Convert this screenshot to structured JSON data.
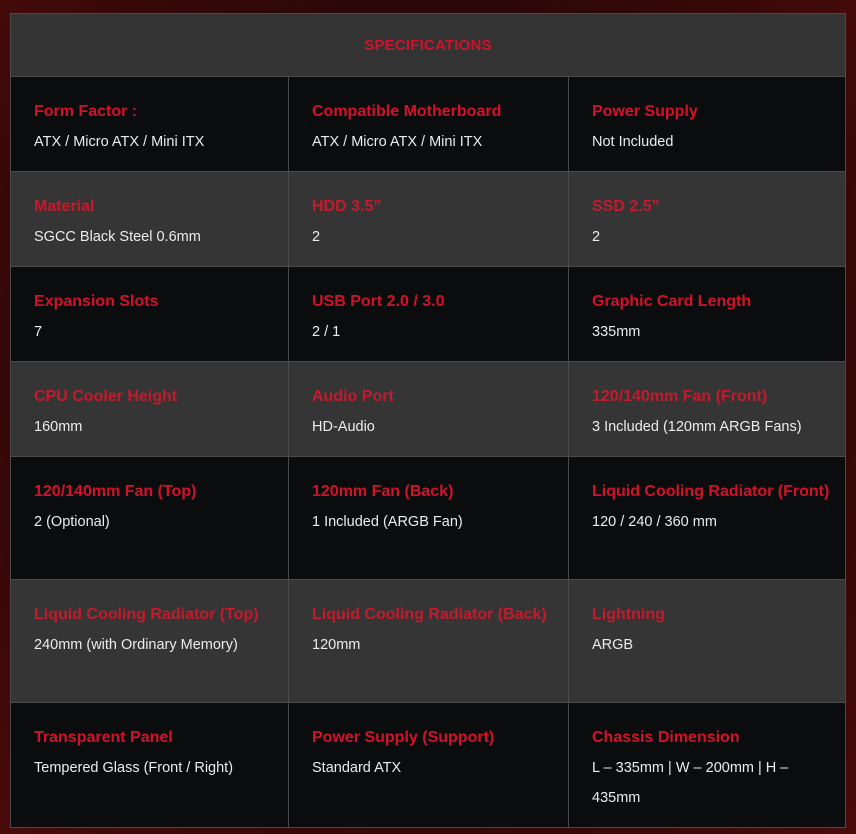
{
  "header": {
    "title": "SPECIFICATIONS"
  },
  "rows": [
    [
      {
        "label": "Form Factor :",
        "value": "ATX / Micro ATX / Mini ITX"
      },
      {
        "label": "Compatible Motherboard",
        "value": "ATX / Micro ATX / Mini ITX"
      },
      {
        "label": "Power Supply",
        "value": "Not Included"
      }
    ],
    [
      {
        "label": "Material",
        "value": "SGCC Black Steel 0.6mm"
      },
      {
        "label": "HDD 3.5”",
        "value": "2"
      },
      {
        "label": "SSD 2.5”",
        "value": "2"
      }
    ],
    [
      {
        "label": "Expansion Slots",
        "value": "7"
      },
      {
        "label": "USB Port 2.0 / 3.0",
        "value": "2 / 1"
      },
      {
        "label": "Graphic Card Length",
        "value": "335mm"
      }
    ],
    [
      {
        "label": "CPU Cooler Height",
        "value": "160mm"
      },
      {
        "label": "Audio Port",
        "value": "HD-Audio"
      },
      {
        "label": "120/140mm Fan (Front)",
        "value": "3 Included (120mm ARGB Fans)"
      }
    ],
    [
      {
        "label": "120/140mm Fan (Top)",
        "value": "2 (Optional)"
      },
      {
        "label": "120mm Fan (Back)",
        "value": "1 Included (ARGB Fan)"
      },
      {
        "label": "Liquid Cooling Radiator (Front)",
        "value": "120 / 240 / 360 mm"
      }
    ],
    [
      {
        "label": "Liquid Cooling Radiator (Top)",
        "value": "240mm (with Ordinary Memory)"
      },
      {
        "label": "Liquid Cooling Radiator (Back)",
        "value": "120mm"
      },
      {
        "label": "Lightning",
        "value": "ARGB"
      }
    ],
    [
      {
        "label": "Transparent Panel",
        "value": "Tempered Glass (Front / Right)"
      },
      {
        "label": "Power Supply (Support)",
        "value": "Standard ATX"
      },
      {
        "label": "Chassis Dimension",
        "value": "L – 335mm | W – 200mm | H – 435mm"
      }
    ]
  ]
}
